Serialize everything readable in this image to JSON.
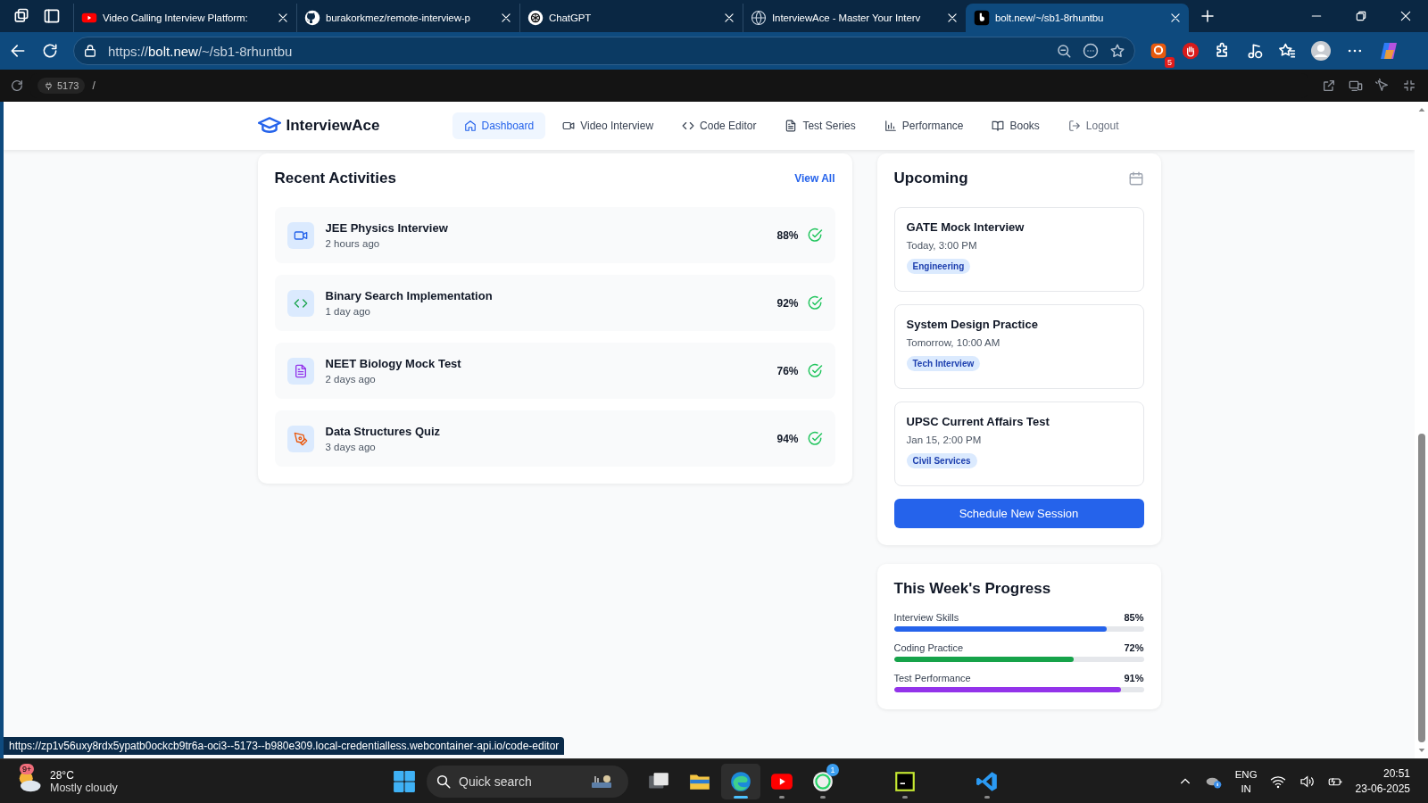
{
  "browser": {
    "tabs": [
      {
        "kind": "youtube",
        "title": "Video Calling Interview Platform:",
        "selected": false
      },
      {
        "kind": "github",
        "title": "burakorkmez/remote-interview-p",
        "selected": false
      },
      {
        "kind": "chatgpt",
        "title": "ChatGPT",
        "selected": false
      },
      {
        "kind": "globe",
        "title": "InterviewAce - Master Your Interv",
        "selected": false
      },
      {
        "kind": "bolt",
        "title": "bolt.new/~/sb1-8rhuntbu",
        "selected": true
      }
    ],
    "address": {
      "prefix": "https://",
      "host": "bolt.new",
      "path": "/~/sb1-8rhuntbu"
    },
    "extension_badge": "5",
    "preview_bar": {
      "port": "5173",
      "path": "/"
    },
    "status_url": "https://zp1v56uxy8rdx5ypatb0ockcb9tr6a-oci3--5173--b980e309.local-credentialless.webcontainer-api.io/code-editor"
  },
  "app": {
    "brand": "InterviewAce",
    "nav": [
      {
        "kind": "home",
        "label": "Dashboard",
        "selected": true
      },
      {
        "kind": "video",
        "label": "Video Interview",
        "selected": false
      },
      {
        "kind": "code",
        "label": "Code Editor",
        "selected": false
      },
      {
        "kind": "file",
        "label": "Test Series",
        "selected": false
      },
      {
        "kind": "chart",
        "label": "Performance",
        "selected": false
      },
      {
        "kind": "book",
        "label": "Books",
        "selected": false
      },
      {
        "kind": "logout",
        "label": "Logout",
        "selected": false
      }
    ],
    "recent": {
      "title": "Recent Activities",
      "link": "View All",
      "items": [
        {
          "kind": "video",
          "title": "JEE Physics Interview",
          "time": "2 hours ago",
          "score": "88%"
        },
        {
          "kind": "code",
          "title": "Binary Search Implementation",
          "time": "1 day ago",
          "score": "92%"
        },
        {
          "kind": "file",
          "title": "NEET Biology Mock Test",
          "time": "2 days ago",
          "score": "76%"
        },
        {
          "kind": "pen",
          "title": "Data Structures Quiz",
          "time": "3 days ago",
          "score": "94%"
        }
      ]
    },
    "upcoming": {
      "title": "Upcoming",
      "items": [
        {
          "title": "GATE Mock Interview",
          "time": "Today, 3:00 PM",
          "tag": "Engineering"
        },
        {
          "title": "System Design Practice",
          "time": "Tomorrow, 10:00 AM",
          "tag": "Tech Interview"
        },
        {
          "title": "UPSC Current Affairs Test",
          "time": "Jan 15, 2:00 PM",
          "tag": "Civil Services"
        }
      ],
      "button": "Schedule New Session"
    },
    "progress": {
      "title": "This Week's Progress",
      "items": [
        {
          "label": "Interview Skills",
          "value": "85%",
          "level": 0.85,
          "color": "#2563eb"
        },
        {
          "label": "Coding Practice",
          "value": "72%",
          "level": 0.72,
          "color": "#16a34a"
        },
        {
          "label": "Test Performance",
          "value": "91%",
          "level": 0.91,
          "color": "#9333ea"
        }
      ]
    }
  },
  "taskbar": {
    "weather": {
      "badge": "9+",
      "temp": "28°C",
      "text": "Mostly cloudy"
    },
    "search": "Quick search",
    "apps": [
      {
        "kind": "files"
      },
      {
        "kind": "explorer"
      },
      {
        "kind": "edge",
        "selected": true
      },
      {
        "kind": "youtube",
        "selected": false
      },
      {
        "kind": "whatsapp",
        "badge": "1",
        "selected": false
      },
      {
        "kind": "pycharm",
        "selected": false
      },
      {
        "kind": "vscode",
        "selected": false
      }
    ],
    "lang": "ENG",
    "region": "IN",
    "time": "20:51",
    "date": "23-06-2025"
  }
}
